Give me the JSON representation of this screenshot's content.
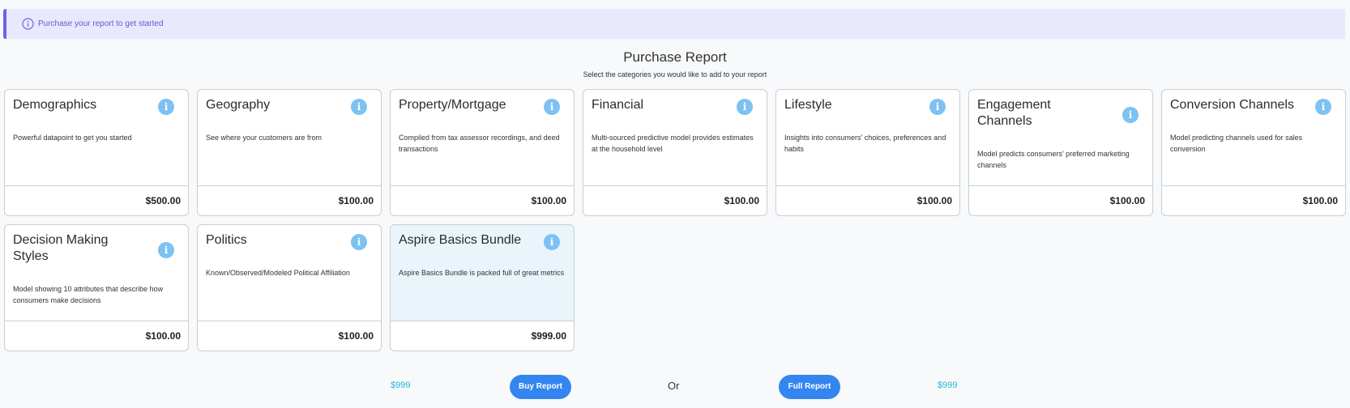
{
  "banner": {
    "text": "Purchase your report to get started",
    "icon": "info-circle-icon",
    "accent": "#6c66e3"
  },
  "page": {
    "title": "Purchase Report",
    "subtitle": "Select the categories you would like to add to your report"
  },
  "cards": [
    {
      "title": "Demographics",
      "description": "Powerful datapoint to get you started",
      "price": "$500.00",
      "icon": "info-icon"
    },
    {
      "title": "Geography",
      "description": "See where your customers are from",
      "price": "$100.00",
      "icon": "info-icon"
    },
    {
      "title": "Property/Mortgage",
      "description": "Compiled from tax assessor recordings, and deed transactions",
      "price": "$100.00",
      "icon": "info-icon"
    },
    {
      "title": "Financial",
      "description": "Multi-sourced predictive model provides estimates at the household level",
      "price": "$100.00",
      "icon": "info-icon"
    },
    {
      "title": "Lifestyle",
      "description": "Insights into consumers' choices, preferences and habits",
      "price": "$100.00",
      "icon": "info-icon"
    },
    {
      "title": "Engagement Channels",
      "description": "Model predicts consumers' preferred marketing channels",
      "price": "$100.00",
      "icon": "info-icon"
    },
    {
      "title": "Conversion Channels",
      "description": "Model predicting channels used for sales conversion",
      "price": "$100.00",
      "icon": "info-icon"
    },
    {
      "title": "Decision Making Styles",
      "description": "Model showing 10 attributes that describe how consumers make decisions",
      "price": "$100.00",
      "icon": "info-icon"
    },
    {
      "title": "Politics",
      "description": "Known/Observed/Modeled Political Affiliation",
      "price": "$100.00",
      "icon": "info-icon"
    },
    {
      "title": "Aspire Basics Bundle",
      "description": "Aspire Basics Bundle is packed full of great metrics",
      "price": "$999.00",
      "icon": "info-icon",
      "selected": true
    }
  ],
  "footer": {
    "selected_total": "$999",
    "buy_button": "Buy Report",
    "or_text": "Or",
    "full_button": "Full Report",
    "full_total": "$999"
  },
  "colors": {
    "primary_button": "#3385f0",
    "price_accent": "#28b8d8",
    "info_icon": "#7ec1f3",
    "selected_card": "#e9f5fb"
  }
}
